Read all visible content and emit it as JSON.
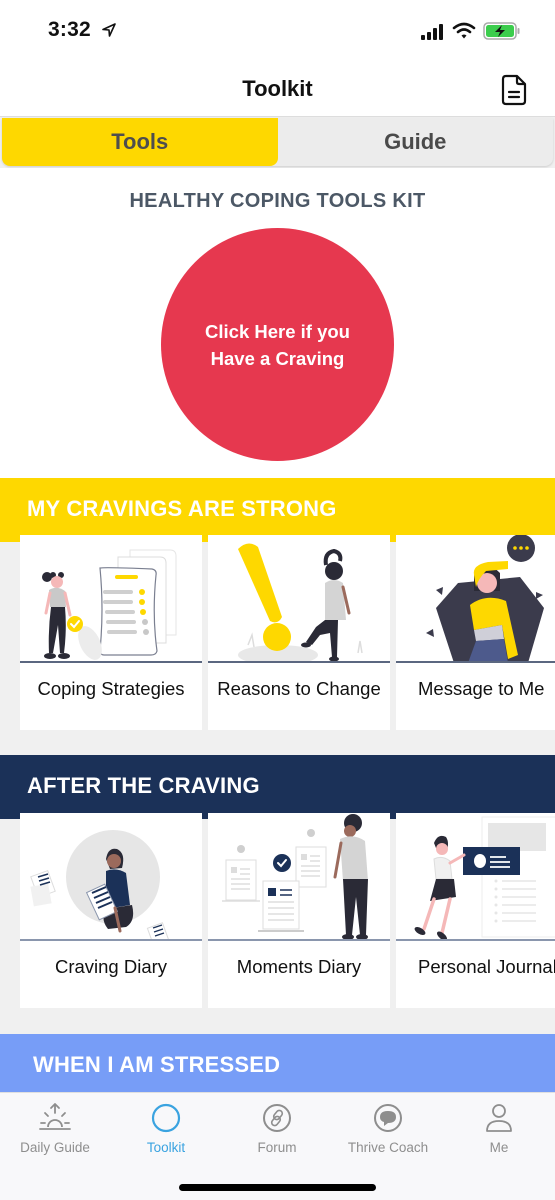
{
  "status_bar": {
    "time": "3:32",
    "icons": [
      "location-arrow-icon",
      "signal-icon",
      "wifi-icon",
      "battery-charging-icon"
    ]
  },
  "header": {
    "title": "Toolkit",
    "right_icon": "document-icon"
  },
  "tabs": [
    {
      "label": "Tools",
      "active": true
    },
    {
      "label": "Guide",
      "active": false
    }
  ],
  "hero": {
    "title": "HEALTHY COPING TOOLS KIT",
    "button_label": "Click Here if you Have a Craving",
    "button_color": "#e6384f"
  },
  "sections": [
    {
      "title": "MY CRAVINGS ARE STRONG",
      "color": "#fed800",
      "cards": [
        {
          "label": "Coping Strategies",
          "illustration": "checklist-illustration"
        },
        {
          "label": "Reasons to Change",
          "illustration": "exclamation-illustration"
        },
        {
          "label": "Message to Me",
          "illustration": "message-illustration"
        }
      ]
    },
    {
      "title": "AFTER THE CRAVING",
      "color": "#1b3158",
      "cards": [
        {
          "label": "Craving Diary",
          "illustration": "diary-illustration"
        },
        {
          "label": "Moments Diary",
          "illustration": "moments-illustration"
        },
        {
          "label": "Personal Journal",
          "illustration": "journal-illustration"
        }
      ]
    },
    {
      "title": "WHEN I AM STRESSED",
      "color": "#779df7",
      "cards": []
    }
  ],
  "tabbar": [
    {
      "label": "Daily Guide",
      "icon": "sunrise-icon",
      "active": false
    },
    {
      "label": "Toolkit",
      "icon": "circle-icon",
      "active": true
    },
    {
      "label": "Forum",
      "icon": "link-icon",
      "active": false
    },
    {
      "label": "Thrive Coach",
      "icon": "chat-bubble-icon",
      "active": false
    },
    {
      "label": "Me",
      "icon": "person-icon",
      "active": false
    }
  ],
  "colors": {
    "accent_yellow": "#fed800",
    "active_tab_blue": "#3aa3e0",
    "navy": "#1b3158"
  }
}
